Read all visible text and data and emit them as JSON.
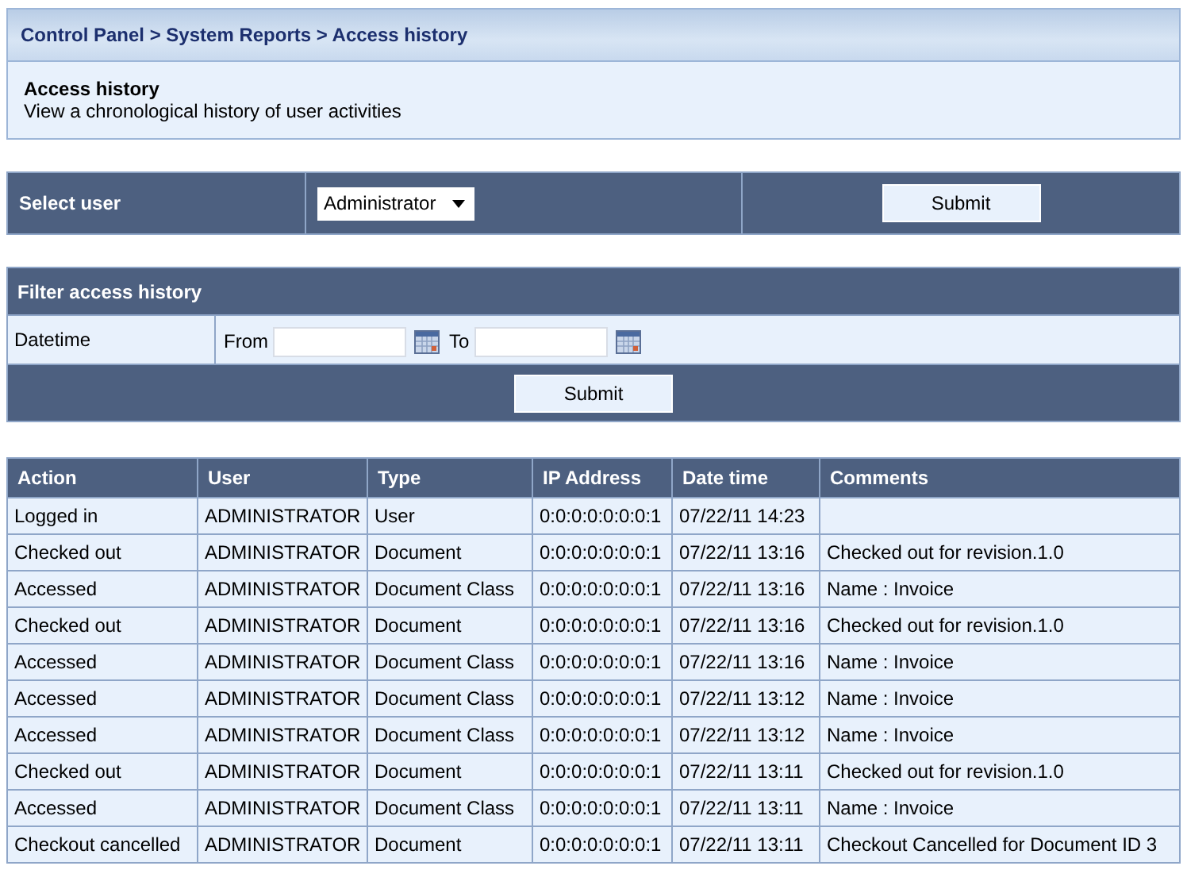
{
  "breadcrumb": "Control Panel > System Reports > Access history",
  "page": {
    "title": "Access history",
    "description": "View a chronological history of user activities"
  },
  "select_user": {
    "label": "Select user",
    "value": "Administrator",
    "button": "Submit"
  },
  "filter": {
    "title": "Filter access history",
    "field_label": "Datetime",
    "from_label": "From",
    "to_label": "To",
    "button": "Submit"
  },
  "table": {
    "columns": [
      "Action",
      "User",
      "Type",
      "IP Address",
      "Date time",
      "Comments"
    ],
    "rows": [
      [
        "Logged in",
        "ADMINISTRATOR",
        "User",
        "0:0:0:0:0:0:0:1",
        "07/22/11 14:23",
        null
      ],
      [
        "Checked out",
        "ADMINISTRATOR",
        "Document",
        "0:0:0:0:0:0:0:1",
        "07/22/11 13:16",
        "Checked out for revision.1.0"
      ],
      [
        "Accessed",
        "ADMINISTRATOR",
        "Document Class",
        "0:0:0:0:0:0:0:1",
        "07/22/11 13:16",
        "Name : Invoice"
      ],
      [
        "Checked out",
        "ADMINISTRATOR",
        "Document",
        "0:0:0:0:0:0:0:1",
        "07/22/11 13:16",
        "Checked out for revision.1.0"
      ],
      [
        "Accessed",
        "ADMINISTRATOR",
        "Document Class",
        "0:0:0:0:0:0:0:1",
        "07/22/11 13:16",
        "Name : Invoice"
      ],
      [
        "Accessed",
        "ADMINISTRATOR",
        "Document Class",
        "0:0:0:0:0:0:0:1",
        "07/22/11 13:12",
        "Name : Invoice"
      ],
      [
        "Accessed",
        "ADMINISTRATOR",
        "Document Class",
        "0:0:0:0:0:0:0:1",
        "07/22/11 13:12",
        "Name : Invoice"
      ],
      [
        "Checked out",
        "ADMINISTRATOR",
        "Document",
        "0:0:0:0:0:0:0:1",
        "07/22/11 13:11",
        "Checked out for revision.1.0"
      ],
      [
        "Accessed",
        "ADMINISTRATOR",
        "Document Class",
        "0:0:0:0:0:0:0:1",
        "07/22/11 13:11",
        "Name : Invoice"
      ],
      [
        "Checkout cancelled",
        "ADMINISTRATOR",
        "Document",
        "0:0:0:0:0:0:0:1",
        "07/22/11 13:11",
        "Checkout Cancelled for Document ID 3"
      ]
    ]
  }
}
